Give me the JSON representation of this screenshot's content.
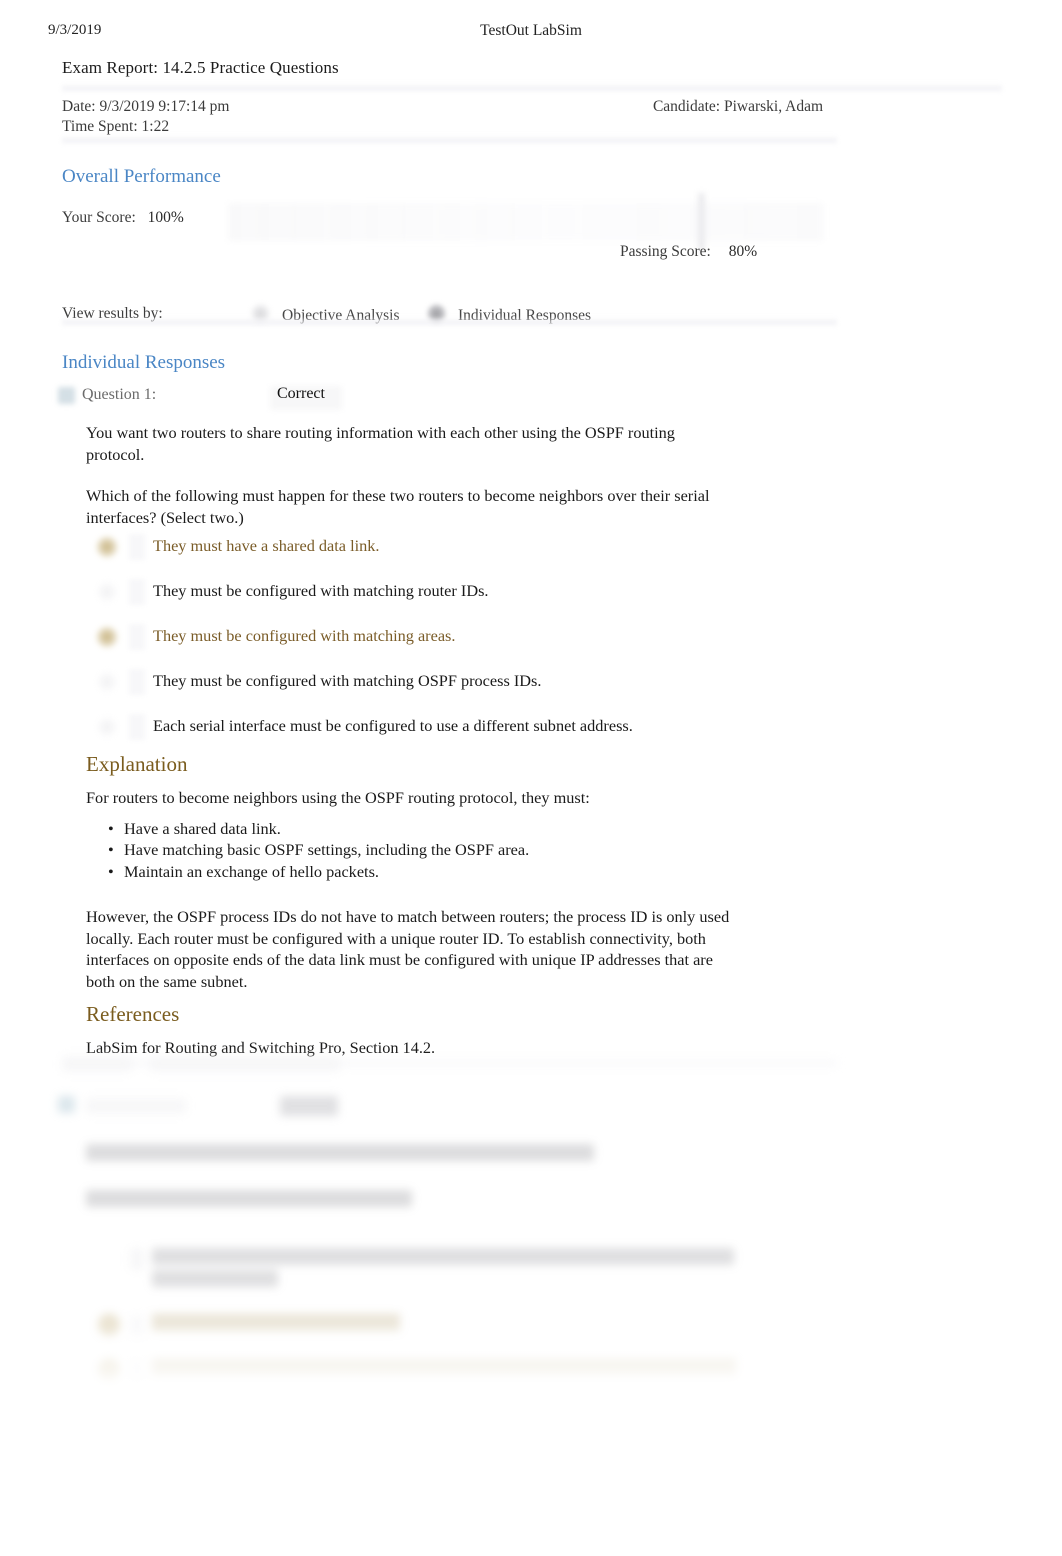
{
  "print_header": {
    "date": "9/3/2019",
    "site_title": "TestOut LabSim"
  },
  "report": {
    "title": "Exam Report: 14.2.5 Practice Questions",
    "date_line": "Date: 9/3/2019 9:17:14 pm",
    "time_spent_line": "Time Spent: 1:22",
    "candidate_line": "Candidate: Piwarski, Adam"
  },
  "overall_performance": {
    "heading": "Overall Performance",
    "your_score_label": "Your Score:",
    "your_score_value": "100%",
    "passing_score_label": "Passing Score:",
    "passing_score_value": "80%"
  },
  "view_results_by": {
    "label": "View results by:",
    "options": [
      {
        "label": "Objective Analysis",
        "selected": false
      },
      {
        "label": "Individual Responses",
        "selected": true
      }
    ]
  },
  "individual_responses": {
    "heading": "Individual Responses",
    "question": {
      "label": "Question 1:",
      "status": "Correct",
      "prompt_1": "You want two routers to share routing information with each other using the OSPF routing protocol.",
      "prompt_2": "Which of the following must happen for these two routers to become neighbors over their serial interfaces? (Select two.)",
      "options": [
        {
          "text": "They must have a shared data link.",
          "chosen": true
        },
        {
          "text": "They must be configured with matching router IDs.",
          "chosen": false
        },
        {
          "text": "They must be configured with matching areas.",
          "chosen": true
        },
        {
          "text": "They must be configured with matching OSPF process IDs.",
          "chosen": false
        },
        {
          "text": "Each serial interface must be configured to use a different subnet address.",
          "chosen": false
        }
      ],
      "explanation": {
        "heading": "Explanation",
        "intro": "For routers to become neighbors using the OSPF routing protocol, they must:",
        "bullets": [
          "Have a shared data link.",
          "Have matching basic OSPF settings, including the OSPF area.",
          "Maintain an exchange of hello packets."
        ],
        "tail": "However, the OSPF process IDs do not have to match between routers; the process ID is only used locally. Each router must be configured with a unique router ID. To establish connectivity, both interfaces on opposite ends of the data link must be configured with unique IP addresses that are both on the same subnet."
      },
      "references": {
        "heading": "References",
        "text": "LabSim for Routing and Switching Pro, Section 14.2."
      }
    }
  },
  "colors": {
    "heading_blue": "#4a86c5",
    "section_heading_brown": "#7a5c1e",
    "chosen_answer_brown": "#7a5c28",
    "body_text": "#1a1a1a",
    "muted_text": "#6b6b6b",
    "page_background": "#ffffff"
  }
}
